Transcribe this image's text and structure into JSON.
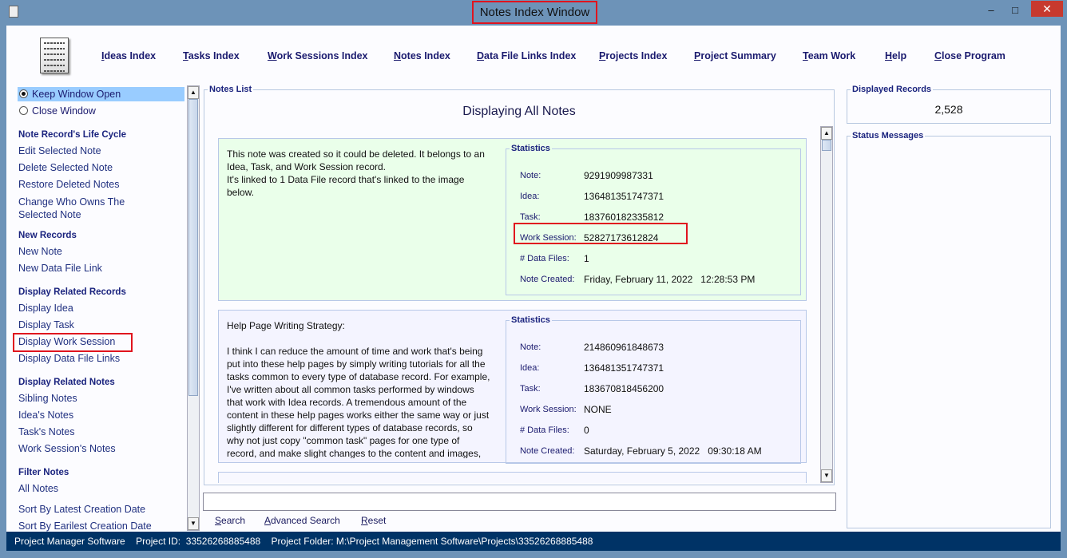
{
  "window": {
    "title": "Notes Index Window",
    "minimize": "–",
    "maximize": "□",
    "close": "✕"
  },
  "nav": [
    "Ideas Index",
    "Tasks Index",
    "Work Sessions Index",
    "Notes Index",
    "Data File Links Index",
    "Projects Index",
    "Project Summary",
    "Team Work",
    "Help",
    "Close Program"
  ],
  "sidebar": {
    "keep_open": "Keep Window Open",
    "close_window": "Close Window",
    "lifecycle": {
      "heading": "Note Record's Life Cycle",
      "items": [
        "Edit Selected Note",
        "Delete Selected Note",
        "Restore Deleted Notes",
        "Change Who Owns The",
        "Selected Note"
      ]
    },
    "new_records": {
      "heading": "New Records",
      "items": [
        "New Note",
        "New Data File Link"
      ]
    },
    "related_records": {
      "heading": "Display Related Records",
      "items": [
        "Display Idea",
        "Display Task",
        "Display Work Session",
        "Display Data File Links"
      ]
    },
    "related_notes": {
      "heading": "Display Related Notes",
      "items": [
        "Sibling Notes",
        "Idea's Notes",
        "Task's Notes",
        "Work Session's Notes"
      ]
    },
    "filter": {
      "heading": "Filter Notes",
      "items": [
        "All Notes",
        "Sort By Latest Creation Date",
        "Sort By Earilest Creation Date"
      ]
    }
  },
  "notes_list": {
    "legend": "Notes List",
    "heading": "Displaying All Notes",
    "stat_legend": "Statistics",
    "labels": {
      "note": "Note:",
      "idea": "Idea:",
      "task": "Task:",
      "work_session": "Work Session:",
      "data_files": "# Data Files:",
      "created": "Note Created:"
    },
    "notes": [
      {
        "text": "This note was created so it could be deleted. It belongs to an Idea, Task, and Work Session record.\nIt's linked to 1 Data File record that's linked to the image below.",
        "note": "9291909987331",
        "idea": "136481351747371",
        "task": "183760182335812",
        "work_session": "52827173612824",
        "data_files": "1",
        "created": "Friday, February 11, 2022   12:28:53 PM",
        "bg": "#eaffea"
      },
      {
        "text": "Help Page Writing Strategy:\n\nI think I can reduce the amount of time and work that's being put into these help pages by simply writing tutorials for all the tasks common to every type of database record. For example, I've written about all common tasks performed by windows that work with Idea records. A tremendous amount of the content in these help pages works either the same way or just slightly different for different types of database records, so why not just copy \"common task\" pages for one type of record, and make slight changes to the content and images, to describe that",
        "note": "214860961848673",
        "idea": "136481351747371",
        "task": "183670818456200",
        "work_session": "NONE",
        "data_files": "0",
        "created": "Saturday, February 5, 2022   09:30:18 AM",
        "bg": "#f4f4ff"
      }
    ]
  },
  "search": {
    "value": "",
    "search": "Search",
    "advanced": "Advanced Search",
    "reset": "Reset"
  },
  "displayed_records": {
    "legend": "Displayed Records",
    "value": "2,528"
  },
  "status_messages": {
    "legend": "Status Messages"
  },
  "statusbar": {
    "app": "Project Manager Software",
    "project_id": "Project ID:  33526268885488",
    "folder": "Project Folder: M:\\Project Management Software\\Projects\\33526268885488"
  },
  "colors": {
    "titlebar": "#6d93b8",
    "statusbar": "#003366",
    "highlight": "#e0141e",
    "selected": "#99ccff"
  }
}
